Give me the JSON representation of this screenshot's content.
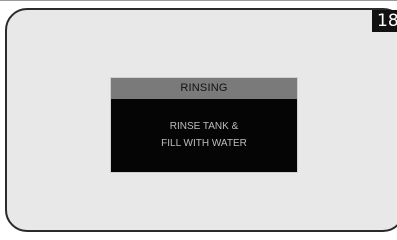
{
  "step": {
    "number": "18"
  },
  "dialog": {
    "title": "RINSING",
    "lines": [
      "RINSE TANK &",
      "FILL WITH WATER"
    ]
  },
  "colors": {
    "screen_background": "#e8e8e8",
    "panel_background": "#050505",
    "header_background": "#7a7a7a",
    "body_text": "#bdbdbd",
    "badge_background": "#111111"
  }
}
